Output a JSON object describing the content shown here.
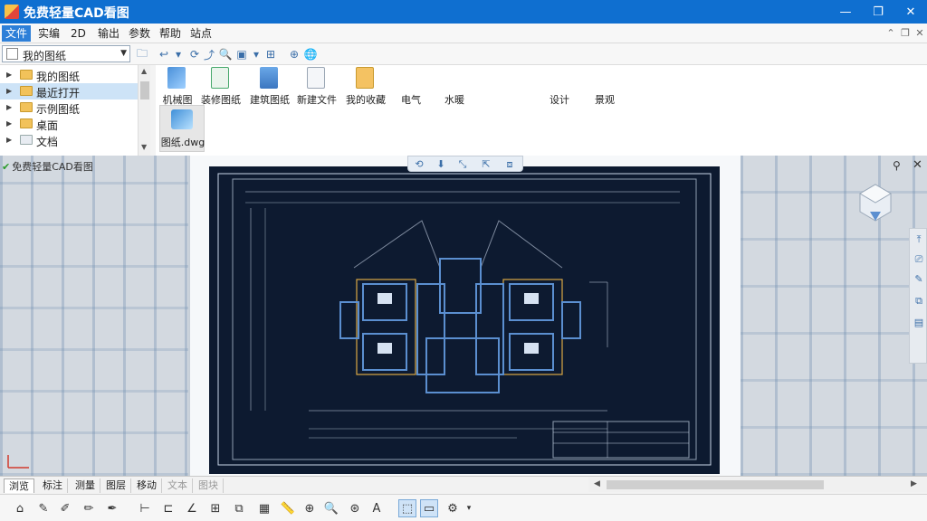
{
  "window": {
    "title": "免费轻量CAD看图",
    "controls": [
      "—",
      "❐",
      "✕"
    ]
  },
  "menu": {
    "items": [
      "文件",
      "实编",
      "2D",
      "输出",
      "参数",
      "帮助",
      "站点"
    ],
    "active_index": 0,
    "mdi_controls": [
      "⌃",
      "❐",
      "✕"
    ]
  },
  "toolbar": {
    "folder": "我的图纸"
  },
  "tree": {
    "items": [
      {
        "label": "我的图纸",
        "selected": false
      },
      {
        "label": "最近打开",
        "selected": true
      },
      {
        "label": "示例图纸",
        "selected": false
      },
      {
        "label": "桌面",
        "selected": false
      },
      {
        "label": "文档",
        "selected": false
      }
    ]
  },
  "files": {
    "items": [
      {
        "label": "机械图",
        "color": "#4a90d9"
      },
      {
        "label": "装修图纸",
        "color": "#47a86b"
      },
      {
        "label": "建筑图纸",
        "color": "#4a86c8"
      },
      {
        "label": "新建文件",
        "color": "#e8ecf2"
      },
      {
        "label": "我的收藏",
        "color": "#f4c262"
      },
      {
        "label": "电气",
        "color": ""
      },
      {
        "label": "水暖",
        "color": ""
      },
      {
        "label": "设计",
        "color": ""
      },
      {
        "label": "景观",
        "color": ""
      }
    ],
    "selected": {
      "label": "图纸.dwg"
    }
  },
  "viewer": {
    "doc_title": "免费轻量CAD看图",
    "right_tools": [
      "⤒",
      "⎚",
      "✎",
      "⧉",
      "▤"
    ]
  },
  "tabs": {
    "items": [
      "浏览",
      "标注",
      "测量",
      "图层",
      "移动",
      "文本",
      "图块"
    ],
    "active_index": 0
  },
  "bottombar": {
    "tools": [
      {
        "name": "new-shape-icon",
        "glyph": "⌂"
      },
      {
        "name": "pencil-icon",
        "glyph": "✎"
      },
      {
        "name": "brush-icon",
        "glyph": "✐"
      },
      {
        "name": "marker-icon",
        "glyph": "✏"
      },
      {
        "name": "pen-icon",
        "glyph": "✒"
      },
      {
        "name": "align-left-icon",
        "glyph": "⊢"
      },
      {
        "name": "align-shape-icon",
        "glyph": "⊏"
      },
      {
        "name": "angle-icon",
        "glyph": "∠"
      },
      {
        "name": "grid-snap-icon",
        "glyph": "⊞"
      },
      {
        "name": "layer-link-icon",
        "glyph": "⧉"
      },
      {
        "name": "building-icon",
        "glyph": "▦"
      },
      {
        "name": "ruler-icon",
        "glyph": "📏"
      },
      {
        "name": "zoom-extent-icon",
        "glyph": "⊕"
      },
      {
        "name": "search-icon",
        "glyph": "🔍"
      },
      {
        "name": "zoom-region-icon",
        "glyph": "⊛"
      },
      {
        "name": "text-icon",
        "glyph": "A"
      },
      {
        "name": "select-icon",
        "glyph": "⬚"
      },
      {
        "name": "window-icon",
        "glyph": "▭"
      },
      {
        "name": "settings-icon",
        "glyph": "⚙"
      }
    ]
  }
}
